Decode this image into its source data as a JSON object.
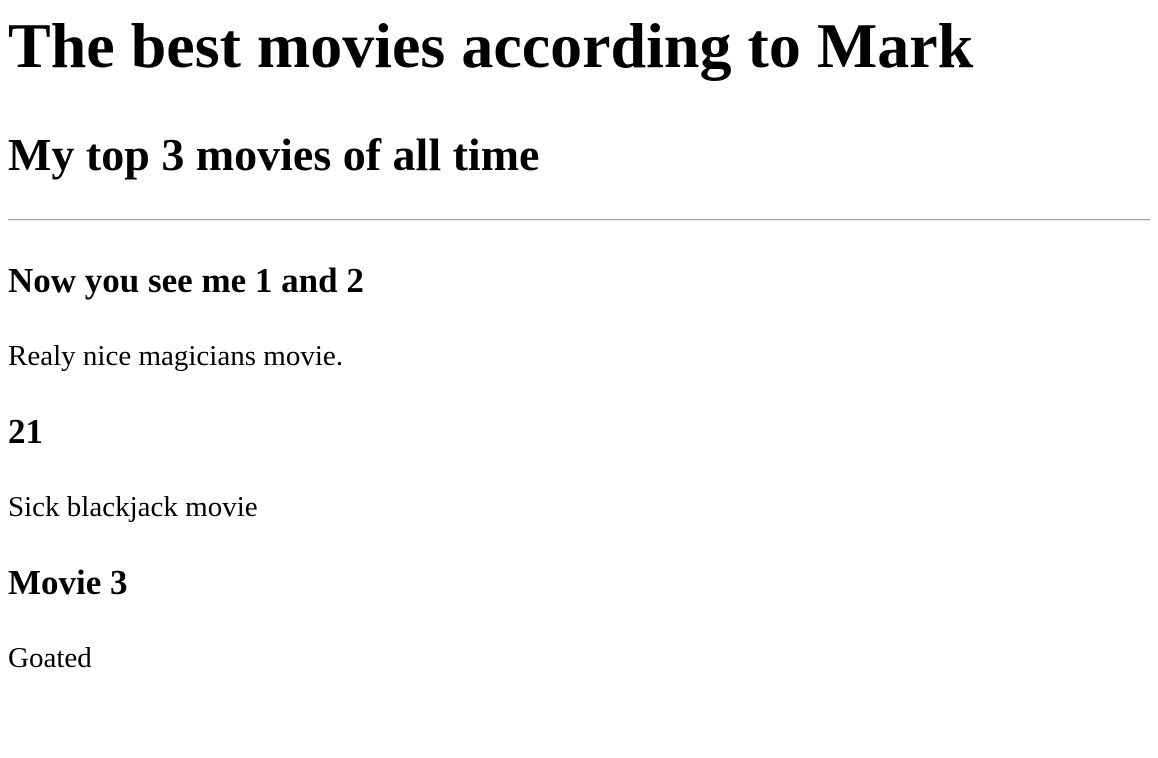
{
  "page": {
    "title": "The best movies according to Mark",
    "subtitle": "My top 3 movies of all time"
  },
  "movies": [
    {
      "title": "Now you see me 1 and 2",
      "description": "Realy nice magicians movie."
    },
    {
      "title": "21",
      "description": "Sick blackjack movie"
    },
    {
      "title": "Movie 3",
      "description": "Goated"
    }
  ]
}
